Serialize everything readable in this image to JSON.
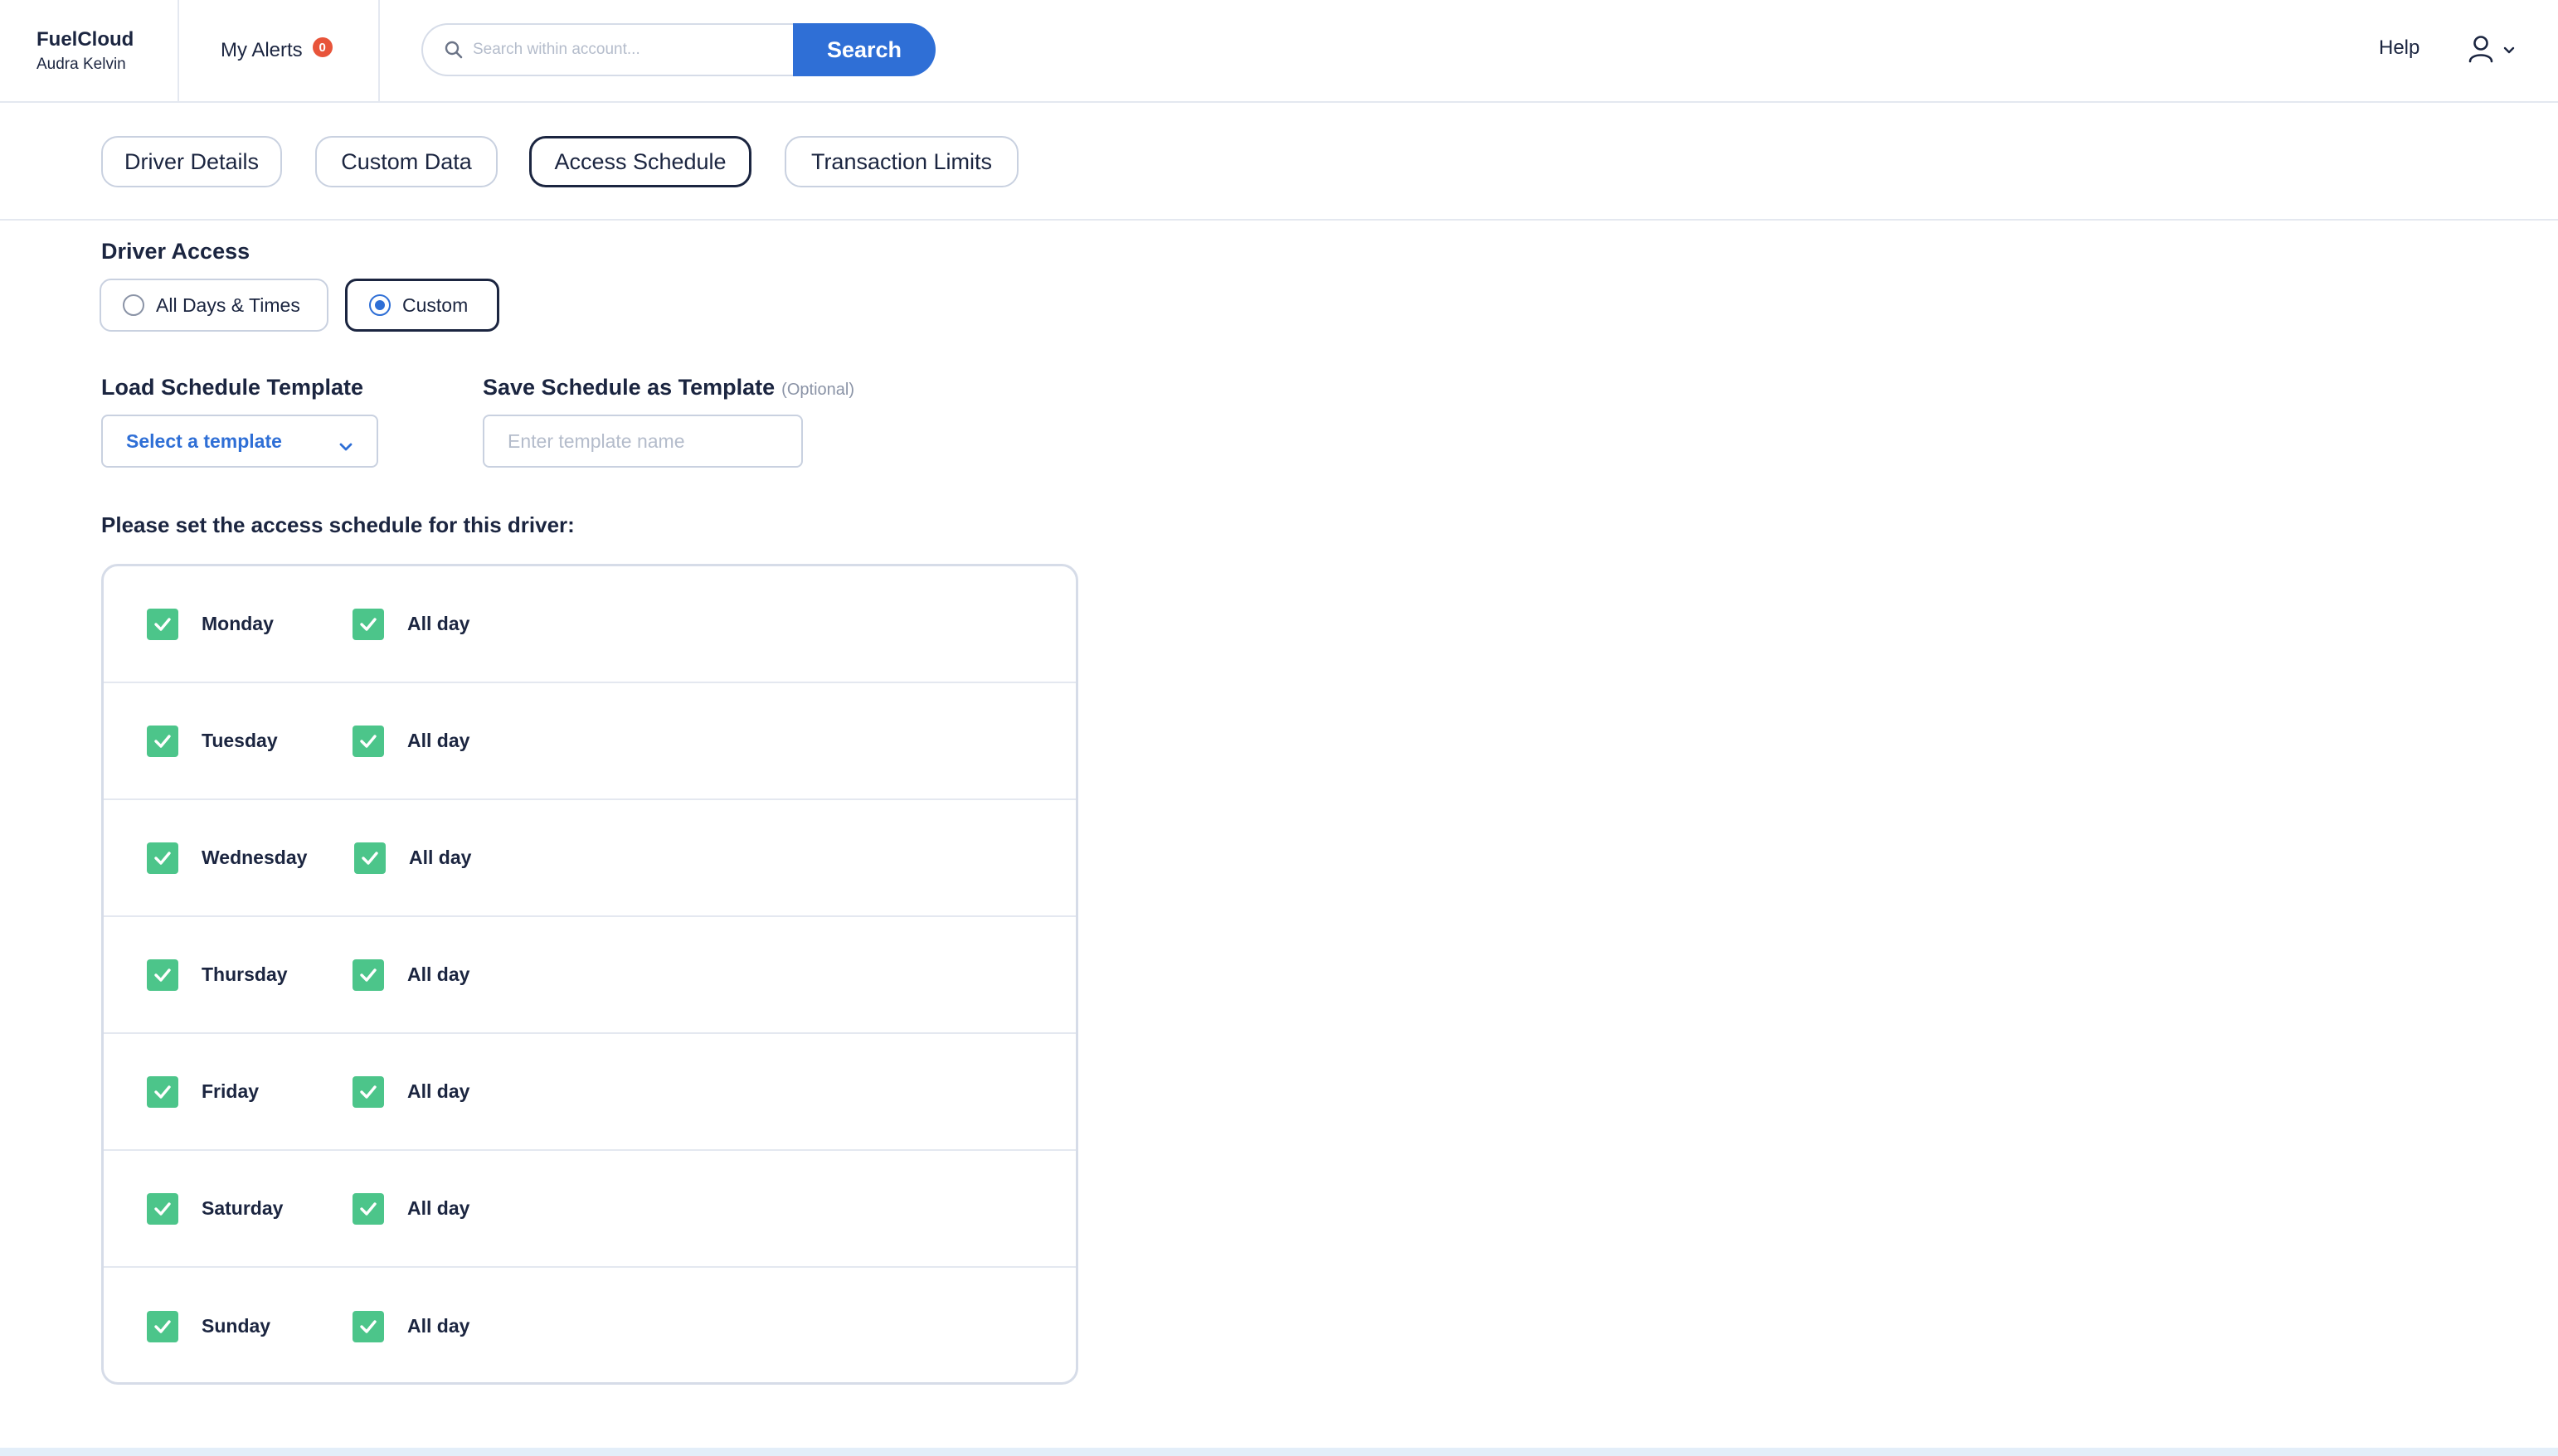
{
  "header": {
    "brand_name": "FuelCloud",
    "user_name": "Audra Kelvin",
    "alerts_label": "My Alerts",
    "alerts_count": "0",
    "search_placeholder": "Search within account...",
    "search_button": "Search",
    "help_label": "Help"
  },
  "tabs": [
    {
      "label": "Driver Details",
      "active": false
    },
    {
      "label": "Custom Data",
      "active": false
    },
    {
      "label": "Access Schedule",
      "active": true
    },
    {
      "label": "Transaction Limits",
      "active": false
    }
  ],
  "driver_access": {
    "label": "Driver Access",
    "options": [
      {
        "label": "All Days & Times",
        "selected": false
      },
      {
        "label": "Custom",
        "selected": true
      }
    ]
  },
  "template": {
    "load_label": "Load Schedule Template",
    "select_value": "Select a template",
    "save_label": "Save Schedule as Template",
    "save_optional": "(Optional)",
    "name_placeholder": "Enter template name"
  },
  "schedule": {
    "prompt": "Please set the access schedule for this driver:",
    "days": [
      {
        "day": "Monday",
        "checked": true,
        "all_day_label": "All day",
        "all_day": true
      },
      {
        "day": "Tuesday",
        "checked": true,
        "all_day_label": "All day",
        "all_day": true
      },
      {
        "day": "Wednesday",
        "checked": true,
        "all_day_label": "All day",
        "all_day": true
      },
      {
        "day": "Thursday",
        "checked": true,
        "all_day_label": "All day",
        "all_day": true
      },
      {
        "day": "Friday",
        "checked": true,
        "all_day_label": "All day",
        "all_day": true
      },
      {
        "day": "Saturday",
        "checked": true,
        "all_day_label": "All day",
        "all_day": true
      },
      {
        "day": "Sunday",
        "checked": true,
        "all_day_label": "All day",
        "all_day": true
      }
    ]
  },
  "colors": {
    "primary": "#2f6fd6",
    "checkbox": "#4cc58a",
    "badge": "#e8543a",
    "text": "#1b2540"
  }
}
